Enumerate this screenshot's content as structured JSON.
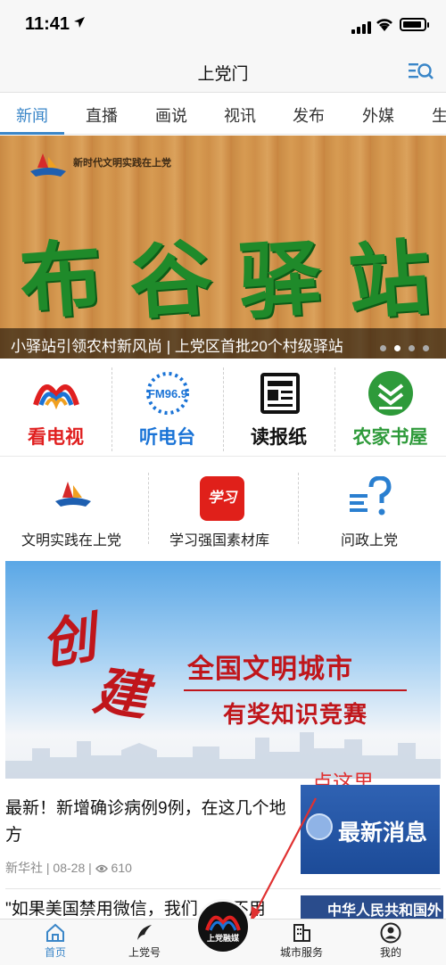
{
  "status_bar": {
    "time": "11:41"
  },
  "header": {
    "title": "上党门"
  },
  "tabs": [
    "新闻",
    "直播",
    "画说",
    "视讯",
    "发布",
    "外媒",
    "生"
  ],
  "banner": {
    "logo_text": "新时代文明实践在上党",
    "artwork_text": [
      "布",
      "谷",
      "驿",
      "站"
    ],
    "caption": "小驿站引领农村新风尚 | 上党区首批20个村级驿站",
    "dots": 4,
    "active_dot": 1
  },
  "media": [
    {
      "label": "看电视",
      "icon": "tv-logo-icon",
      "color": "#e02020"
    },
    {
      "label": "听电台",
      "icon": "radio-fm96-icon",
      "color": "#1a73d6",
      "badge": "FM96.9"
    },
    {
      "label": "读报纸",
      "icon": "newspaper-icon",
      "color": "#111111"
    },
    {
      "label": "农家书屋",
      "icon": "book-house-icon",
      "color": "#2e9a3a"
    }
  ],
  "services": [
    {
      "label": "文明实践在上党",
      "icon": "civilization-logo-icon"
    },
    {
      "label": "学习强国素材库",
      "icon": "xuexi-icon",
      "badge": "学习"
    },
    {
      "label": "问政上党",
      "icon": "question-icon"
    }
  ],
  "promo": {
    "big_chars": [
      "创",
      "建"
    ],
    "line1": "全国文明城市",
    "line2": "有奖知识竞赛"
  },
  "news": [
    {
      "headline": "最新！新增确诊病例9例，在这几个地方",
      "source": "新华社",
      "date": "08-28",
      "views": "610",
      "thumb_text": "最新消息"
    },
    {
      "headline": "\"如果美国禁用微信，我们……不用",
      "thumb_text": "中华人民共和国外"
    }
  ],
  "annotation": "点这里",
  "tabbar": [
    {
      "label": "首页",
      "icon": "home-icon",
      "active": true
    },
    {
      "label": "上党号",
      "icon": "feather-icon",
      "active": false
    },
    {
      "label": "城市服务",
      "icon": "building-icon",
      "active": false
    },
    {
      "label": "我的",
      "icon": "user-icon",
      "active": false
    }
  ],
  "center_button": {
    "label": "上党融媒"
  },
  "colors": {
    "accent": "#3a86c8",
    "annotation": "#e03131"
  }
}
